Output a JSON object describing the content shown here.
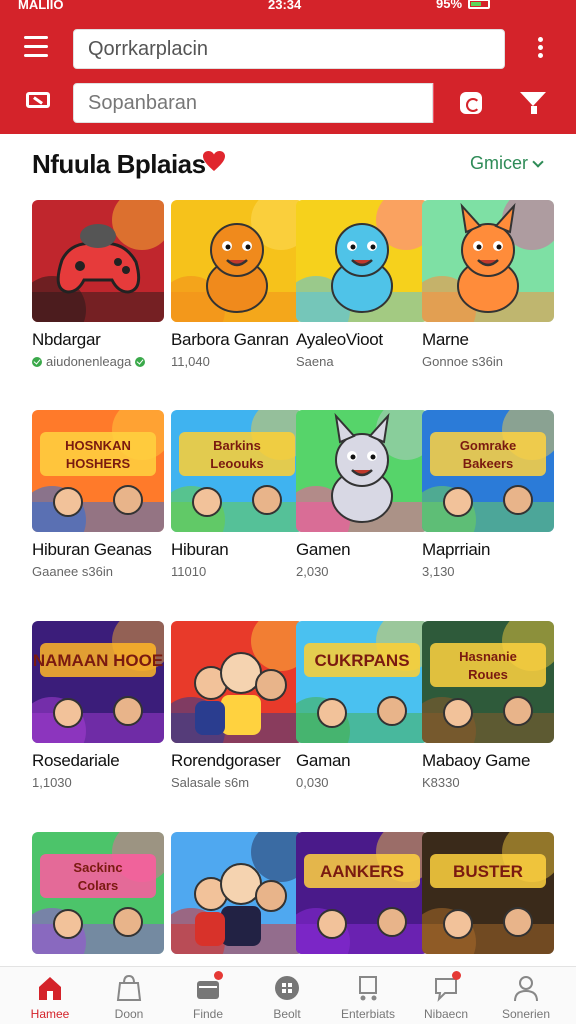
{
  "status_bar": {
    "left": "MALIIO",
    "time": "23:34",
    "battery": "95%"
  },
  "header": {
    "top_input_value": "Qorrkarplacin",
    "search_placeholder": "Sopanbaran"
  },
  "section": {
    "title": "Nfuula Bplaias",
    "link_label": "Gmicer"
  },
  "games": [
    {
      "title": "Nbdargar",
      "sub": "aiudonenleaga",
      "verified": true,
      "colors": [
        "#c0262d",
        "#2a1a1a",
        "#ffcc33"
      ],
      "icon": "controller"
    },
    {
      "title": "Barbora Ganran",
      "sub": "11,040",
      "colors": [
        "#f6c21b",
        "#f28c1c",
        "#ffe066"
      ],
      "icon": "bear"
    },
    {
      "title": "AyaleoVioot",
      "sub": "Saena",
      "colors": [
        "#f6d11c",
        "#4fc3e8",
        "#ff69b4"
      ],
      "icon": "creature"
    },
    {
      "title": "Marne",
      "sub": "Gonnoe s36in",
      "colors": [
        "#7ee0a4",
        "#ff8c3a",
        "#e84a9c"
      ],
      "icon": "fox"
    },
    {
      "title": "Hiburan Geanas",
      "sub": "Gaanee s36in",
      "colors": [
        "#ff7a2a",
        "#2a6edb",
        "#ffd23f"
      ],
      "icon": "banner"
    },
    {
      "title": "Hiburan",
      "sub": "11010",
      "colors": [
        "#3fb3f0",
        "#6ccf3f",
        "#ffcf33"
      ],
      "icon": "banner"
    },
    {
      "title": "Gamen",
      "sub": "2,030",
      "colors": [
        "#56d46a",
        "#ff4fa3",
        "#c8c8d8"
      ],
      "icon": "rabbit"
    },
    {
      "title": "Maprriain",
      "sub": "3,130",
      "colors": [
        "#2b7bd8",
        "#6ed15a",
        "#ffd23f"
      ],
      "icon": "banner"
    },
    {
      "title": "Rosedariale",
      "sub": "1,1030",
      "colors": [
        "#3b1d7a",
        "#a43cd1",
        "#ffb627"
      ],
      "icon": "banner"
    },
    {
      "title": "Rorendgoraser",
      "sub": "Salasale s6m",
      "colors": [
        "#e83a2a",
        "#2a3d8f",
        "#ffd23f"
      ],
      "icon": "crowd"
    },
    {
      "title": "Gaman",
      "sub": "0,030",
      "colors": [
        "#4ac1f0",
        "#46b04a",
        "#ffcf33"
      ],
      "icon": "banner"
    },
    {
      "title": "Mabaoy Game",
      "sub": "K8330",
      "colors": [
        "#2e5a3a",
        "#8c5a2a",
        "#ffd23f"
      ],
      "icon": "banner"
    },
    {
      "title": "",
      "sub": "",
      "colors": [
        "#4cc46a",
        "#9b4fd8",
        "#ff5aa0"
      ],
      "icon": "banner"
    },
    {
      "title": "",
      "sub": "",
      "colors": [
        "#4fa8f0",
        "#d8322a",
        "#222244"
      ],
      "icon": "crowd"
    },
    {
      "title": "",
      "sub": "",
      "colors": [
        "#4a1a8a",
        "#8a2ad8",
        "#ffd23f"
      ],
      "icon": "banner"
    },
    {
      "title": "",
      "sub": "",
      "colors": [
        "#3a2a1a",
        "#a86a2a",
        "#ffd23f"
      ],
      "icon": "banner"
    }
  ],
  "thumb_texts": {
    "4": "HOSNKAN HOSHERS",
    "5": "Barkins Leoouks",
    "7": "Gomrake Bakeers",
    "8": "NAMAAN HOOE",
    "10": "CUKRPANS",
    "11": "Hasnanie Roues",
    "12": "Sackinc Colars",
    "14": "AANKERS",
    "15": "BUSTER"
  },
  "nav": [
    {
      "label": "Hamee",
      "icon": "home-icon",
      "active": true
    },
    {
      "label": "Doon",
      "icon": "bag-icon"
    },
    {
      "label": "Finde",
      "icon": "wallet-icon",
      "badge": true
    },
    {
      "label": "Beolt",
      "icon": "grid-icon"
    },
    {
      "label": "Enterbiats",
      "icon": "cart-icon"
    },
    {
      "label": "Nibaecn",
      "icon": "chat-icon",
      "badge": true
    },
    {
      "label": "Sonerien",
      "icon": "user-icon"
    }
  ],
  "colors": {
    "brand": "#d4232a",
    "accent": "#2e8b57"
  }
}
